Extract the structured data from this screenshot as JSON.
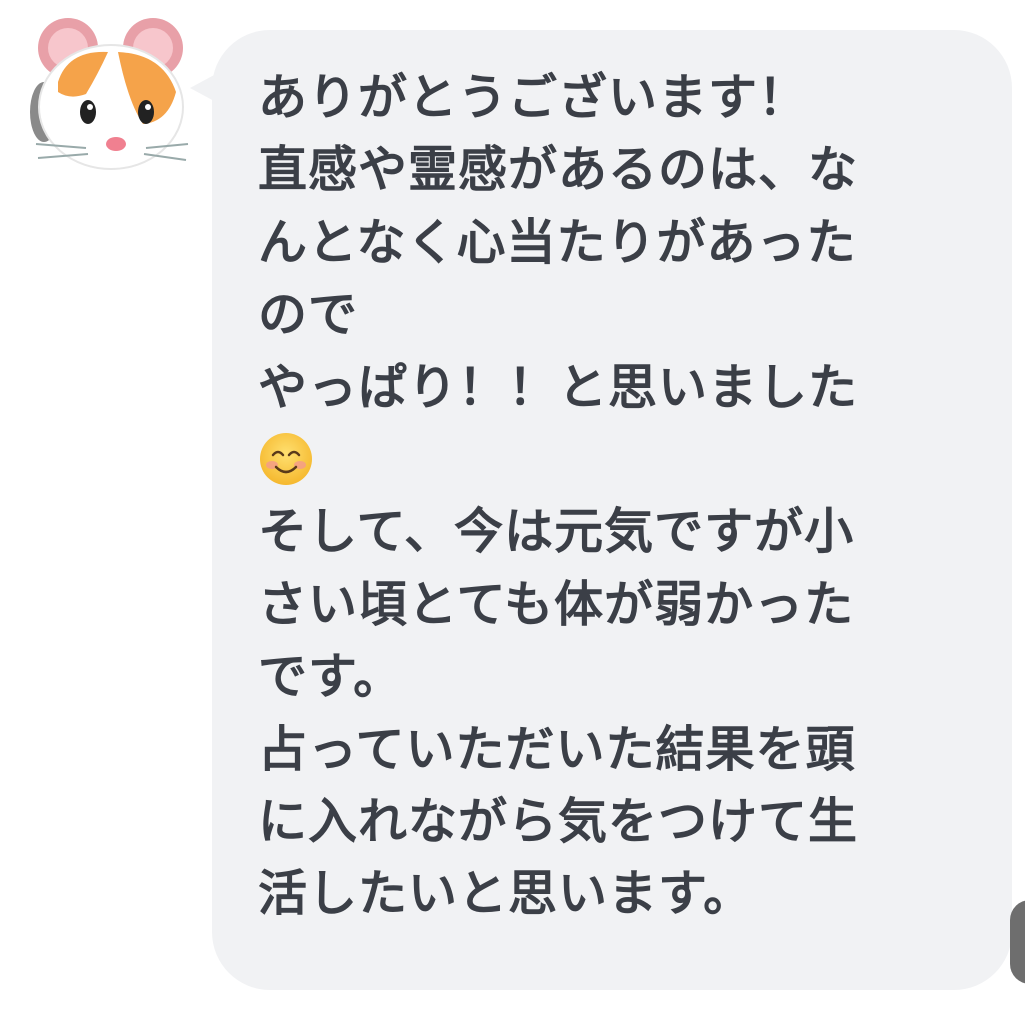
{
  "message": {
    "lines": [
      "ありがとうございます！",
      "直感や霊感があるのは、な",
      "んとなく心当たりがあった",
      "ので",
      "やっぱり！！と思いました",
      "",
      "そして、今は元気ですが小",
      "さい頃とても体が弱かった",
      "です。",
      "占っていただいた結果を頭",
      "に入れながら気をつけて生",
      "活したいと思います。"
    ],
    "emoji": "smiling-face-with-blushing-cheeks"
  },
  "sender": {
    "avatar": "hamster-face-emoji"
  },
  "colors": {
    "bubble": "#f1f2f4",
    "text": "#3b3f47",
    "background": "#ffffff"
  }
}
